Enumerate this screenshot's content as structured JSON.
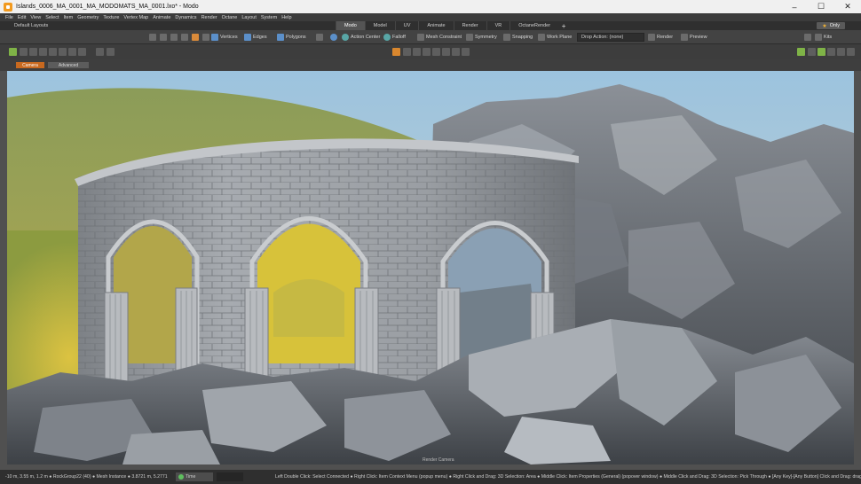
{
  "window": {
    "title": "Islands_0006_MA_0001_MA_MODOMATS_MA_0001.lxo* - Modo",
    "minimize": "–",
    "maximize": "☐",
    "close": "✕"
  },
  "menu": [
    "File",
    "Edit",
    "View",
    "Select",
    "Item",
    "Geometry",
    "Texture",
    "Vertex Map",
    "Animate",
    "Dynamics",
    "Render",
    "Octane",
    "Layout",
    "System",
    "Help"
  ],
  "layout_label": "Default Layouts",
  "tabs": [
    {
      "label": "Modo",
      "active": true
    },
    {
      "label": "Model",
      "active": false
    },
    {
      "label": "UV",
      "active": false
    },
    {
      "label": "Animate",
      "active": false
    },
    {
      "label": "Render",
      "active": false
    },
    {
      "label": "VR",
      "active": false
    },
    {
      "label": "OctaneRender",
      "active": false
    }
  ],
  "tab_add": "+",
  "only_label": "Only",
  "toolbar": {
    "vertices": "Vertices",
    "edges": "Edges",
    "polygons": "Polygons",
    "action_center": "Action Center",
    "falloff": "Falloff",
    "mesh_constraint": "Mesh Constraint",
    "symmetry": "Symmetry",
    "snapping": "Snapping",
    "work_plane": "Work Plane",
    "drop_action": "Drop Action: (none)",
    "render": "Render",
    "preview": "Preview",
    "kits": "Kits"
  },
  "viewport": {
    "camera_tab": "Camera",
    "mode_tab": "Advanced",
    "render_label": "Render Camera"
  },
  "status": {
    "coords": "-10 m, 3.55 m, 1.2 m ● RockGroup22 (40) ● Mesh Instance ● 3.8721 m, 5.2771",
    "time_label": "Time",
    "hints": "Left Double Click: Select Connected ● Right Click: Item Context Menu (popup menu) ● Right Click and Drag: 3D Selection: Area ● Middle Click: Item Properties (General) (popover window) ● Middle Click and Drag: 3D Selection: Pick Through ● [Any Key]-[Any Button] Click and Drag: dragDropBegin"
  },
  "colors": {
    "accent": "#c8691f",
    "sky": "#8fb6d6",
    "stone": "#9a9ea3"
  }
}
